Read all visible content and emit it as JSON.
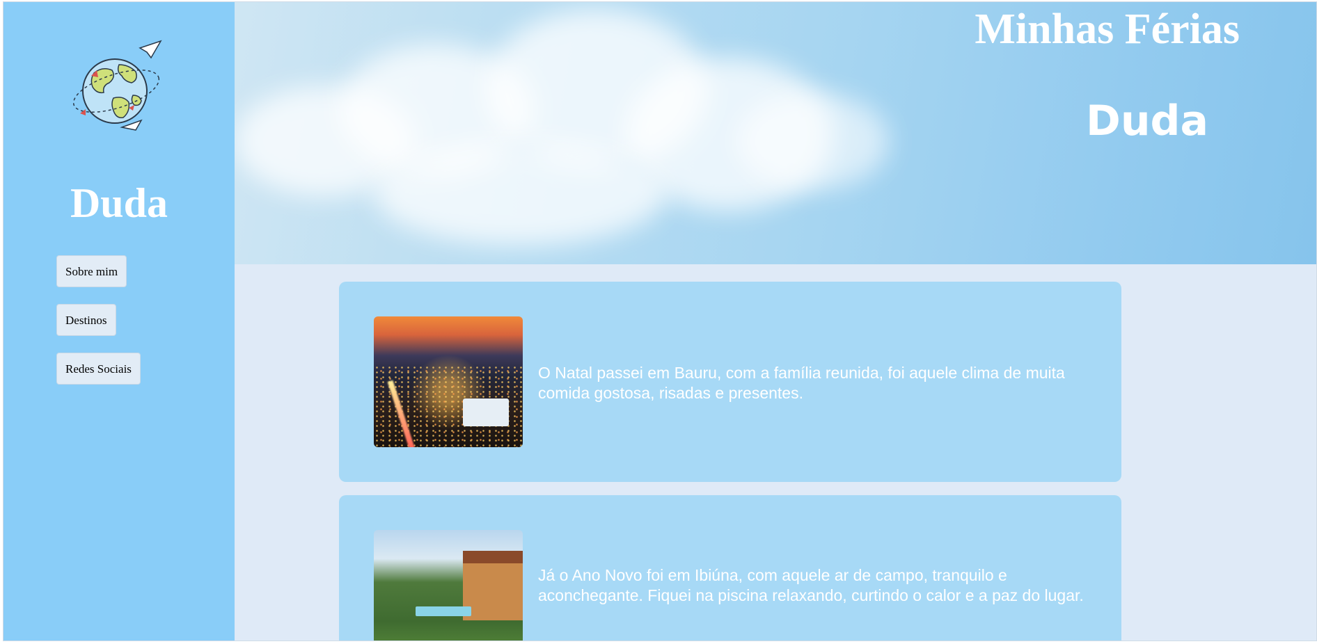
{
  "sidebar": {
    "logo_icon": "globe-with-paper-planes-icon",
    "title": "Duda",
    "nav": [
      {
        "label": "Sobre mim"
      },
      {
        "label": "Destinos"
      },
      {
        "label": "Redes Sociais"
      }
    ]
  },
  "banner": {
    "title": "Minhas Férias",
    "subtitle": "Duda"
  },
  "posts": [
    {
      "image": "city-night-bauru",
      "text": "O Natal passei em Bauru, com a família reunida, foi aquele clima de muita comida gostosa, risadas e presentes."
    },
    {
      "image": "pool-house-ibiuna",
      "text": "Já o Ano Novo foi em Ibiúna, com aquele ar de campo, tranquilo e aconchegante. Fiquei na piscina relaxando, curtindo o calor e a paz do lugar."
    }
  ],
  "colors": {
    "sidebar_bg": "#89cdf8",
    "page_bg": "#dfeaf7",
    "card_bg": "#a7d9f6",
    "text_light": "#ffffff"
  }
}
